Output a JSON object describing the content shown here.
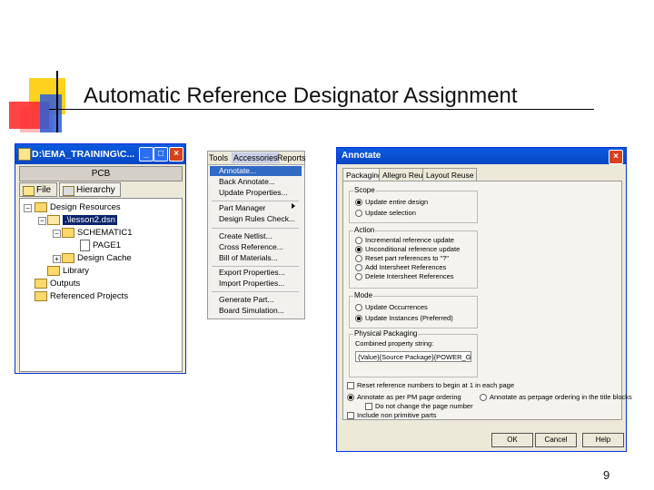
{
  "slide": {
    "title": "Automatic Reference Designator Assignment",
    "page_number": "9"
  },
  "project_window": {
    "title": "D:\\EMA_TRAINING\\C...",
    "header": "PCB",
    "tabs": [
      "File",
      "Hierarchy"
    ],
    "tree": [
      {
        "label": "Design Resources"
      },
      {
        "label": ".\\lesson2.dsn"
      },
      {
        "label": "SCHEMATIC1"
      },
      {
        "label": "PAGE1"
      },
      {
        "label": "Design Cache"
      },
      {
        "label": "Library"
      },
      {
        "label": "Outputs"
      },
      {
        "label": "Referenced Projects"
      }
    ],
    "buttons": {
      "minimize": "_",
      "maximize": "□",
      "close": "×"
    }
  },
  "tools_menu": {
    "menubar": [
      "Tools",
      "Accessories",
      "Reports"
    ],
    "items": [
      "Annotate...",
      "Back Annotate...",
      "Update Properties...",
      "Part Manager",
      "Design Rules Check...",
      "Create Netlist...",
      "Cross Reference...",
      "Bill of Materials...",
      "Export Properties...",
      "Import Properties...",
      "Generate Part...",
      "Board Simulation..."
    ]
  },
  "annotate_dialog": {
    "title": "Annotate",
    "close_label": "×",
    "tabs": [
      "Packaging",
      "Allegro Reuse",
      "Layout Reuse"
    ],
    "scope": {
      "label": "Scope",
      "options": [
        "Update entire design",
        "Update selection"
      ],
      "selected": 0
    },
    "action": {
      "label": "Action",
      "options": [
        "Incremental reference update",
        "Unconditional reference update",
        "Reset part references to \"?\"",
        "Add Intersheet References",
        "Delete Intersheet References"
      ],
      "selected": 1
    },
    "mode": {
      "label": "Mode",
      "options": [
        "Update Occurrences",
        "Update Instances (Preferred)"
      ],
      "selected": 1
    },
    "physical_packaging": {
      "label": "Physical Packaging",
      "sublabel": "Combined property string:",
      "value": "{Value}{Source Package}{POWER_GRO"
    },
    "reset_check": "Reset reference numbers to begin at 1 in each page",
    "ordering": {
      "options": [
        "Annotate as per PM page ordering",
        "Annotate as perpage ordering in the title blocks"
      ],
      "selected": 0
    },
    "no_change_page": "Do not change the page number",
    "include_nonprimitive": "Include non primitive parts",
    "buttons": [
      "OK",
      "Cancel",
      "Help"
    ]
  }
}
